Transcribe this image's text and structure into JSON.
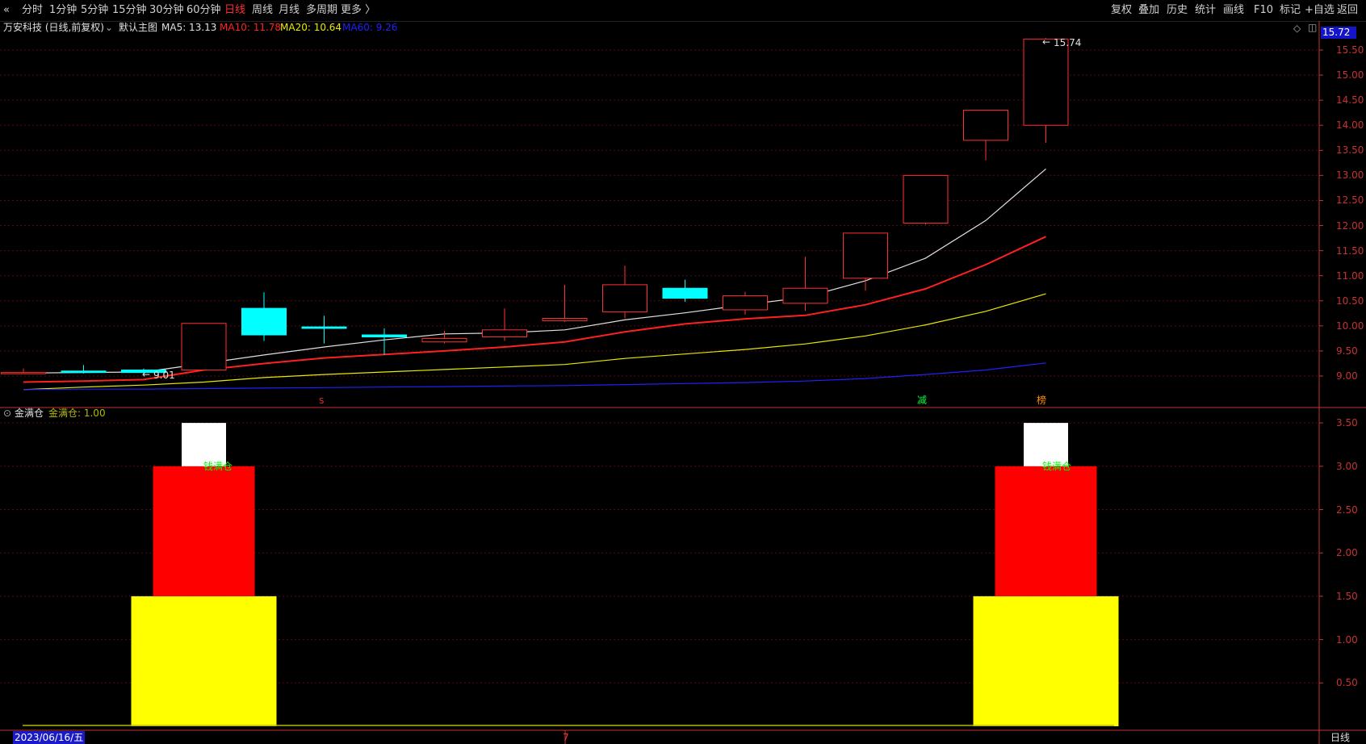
{
  "toolbar": {
    "back_glyph": "«",
    "periods": [
      "分时",
      "1分钟",
      "5分钟",
      "15分钟",
      "30分钟",
      "60分钟",
      "日线",
      "周线",
      "月线",
      "多周期",
      "更多 〉"
    ],
    "active_period": "日线",
    "right_buttons": [
      "复权",
      "叠加",
      "历史",
      "统计",
      "画线",
      "F10",
      "标记",
      "+自选",
      "返回"
    ]
  },
  "main_panel": {
    "stock_label": "万安科技 (日线,前复权)",
    "indicator_name": "默认主图",
    "ma5": "MA5: 13.13",
    "ma10": "MA10: 11.78",
    "ma20": "MA20: 10.64",
    "ma60": "MA60: 9.26",
    "current_price": "15.72",
    "high_marker": "15.74",
    "low_marker": "9.01",
    "signal_s": "S",
    "signal_jian": "减",
    "signal_bang": "榜",
    "ma_colors": {
      "ma5": "#e0e0e0",
      "ma10": "#ff2020",
      "ma20": "#e8e800",
      "ma60": "#2020ff"
    },
    "up_color": "#ff3030",
    "down_color": "#00ffff"
  },
  "sub_panel": {
    "title": "金满仓",
    "value_label": "金满仓: 1.00",
    "signal_text": "钱满仓"
  },
  "status": {
    "date": "2023/06/16/五",
    "mid_marker": "7",
    "period": "日线"
  },
  "chart_data": [
    {
      "type": "candlestick",
      "title": "万安科技 (日线,前复权)",
      "y_ticks": [
        9.0,
        9.5,
        10.0,
        10.5,
        11.0,
        11.5,
        12.0,
        12.5,
        13.0,
        13.5,
        14.0,
        14.5,
        15.0,
        15.5
      ],
      "ylim": [
        8.6,
        15.85
      ],
      "candles": [
        {
          "o": 9.07,
          "h": 9.15,
          "l": 9.05,
          "c": 9.07
        },
        {
          "o": 9.1,
          "h": 9.22,
          "l": 9.05,
          "c": 9.07
        },
        {
          "o": 9.12,
          "h": 9.15,
          "l": 9.01,
          "c": 9.07
        },
        {
          "o": 9.12,
          "h": 10.05,
          "l": 9.12,
          "c": 10.05
        },
        {
          "o": 10.35,
          "h": 10.67,
          "l": 9.7,
          "c": 9.82
        },
        {
          "o": 9.98,
          "h": 10.2,
          "l": 9.65,
          "c": 9.95
        },
        {
          "o": 9.82,
          "h": 9.95,
          "l": 9.42,
          "c": 9.78
        },
        {
          "o": 9.68,
          "h": 9.9,
          "l": 9.65,
          "c": 9.75
        },
        {
          "o": 9.78,
          "h": 10.35,
          "l": 9.7,
          "c": 9.92
        },
        {
          "o": 10.1,
          "h": 10.82,
          "l": 10.08,
          "c": 10.15
        },
        {
          "o": 10.28,
          "h": 11.2,
          "l": 10.15,
          "c": 10.82
        },
        {
          "o": 10.75,
          "h": 10.92,
          "l": 10.48,
          "c": 10.55
        },
        {
          "o": 10.32,
          "h": 10.68,
          "l": 10.22,
          "c": 10.6
        },
        {
          "o": 10.45,
          "h": 11.38,
          "l": 10.3,
          "c": 10.75
        },
        {
          "o": 10.95,
          "h": 11.85,
          "l": 10.7,
          "c": 11.85
        },
        {
          "o": 12.05,
          "h": 13.0,
          "l": 12.02,
          "c": 13.0
        },
        {
          "o": 13.7,
          "h": 14.3,
          "l": 13.3,
          "c": 14.3
        },
        {
          "o": 14.0,
          "h": 15.74,
          "l": 13.65,
          "c": 15.72
        }
      ],
      "series": [
        {
          "name": "MA5",
          "values": [
            9.06,
            9.07,
            9.08,
            9.25,
            9.42,
            9.58,
            9.72,
            9.84,
            9.86,
            9.92,
            10.12,
            10.26,
            10.42,
            10.57,
            10.9,
            11.35,
            12.1,
            13.13
          ]
        },
        {
          "name": "MA10",
          "values": [
            8.88,
            8.9,
            8.93,
            9.12,
            9.25,
            9.36,
            9.43,
            9.5,
            9.58,
            9.68,
            9.88,
            10.04,
            10.14,
            10.21,
            10.42,
            10.74,
            11.22,
            11.78
          ]
        },
        {
          "name": "MA20",
          "values": [
            8.73,
            8.78,
            8.82,
            8.88,
            8.97,
            9.03,
            9.08,
            9.13,
            9.18,
            9.23,
            9.35,
            9.44,
            9.53,
            9.64,
            9.8,
            10.02,
            10.29,
            10.64
          ]
        },
        {
          "name": "MA60",
          "values": [
            8.73,
            8.74,
            8.74,
            8.75,
            8.76,
            8.77,
            8.78,
            8.79,
            8.8,
            8.81,
            8.83,
            8.85,
            8.87,
            8.9,
            8.95,
            9.03,
            9.12,
            9.26
          ]
        }
      ]
    },
    {
      "type": "bar",
      "title": "金满仓",
      "y_ticks": [
        0.5,
        1.0,
        1.5,
        2.0,
        2.5,
        3.0,
        3.5
      ],
      "ylim": [
        0,
        3.55
      ],
      "signals": [
        {
          "candle_index": 3,
          "layers": [
            {
              "value": 1.5,
              "color": "#ffff00",
              "width": "wide"
            },
            {
              "value": 3.0,
              "color": "#ff0000",
              "width": "mid"
            },
            {
              "value": 3.5,
              "color": "#ffffff",
              "width": "narrow"
            }
          ]
        },
        {
          "candle_index": 17,
          "layers": [
            {
              "value": 1.5,
              "color": "#ffff00",
              "width": "wide"
            },
            {
              "value": 3.0,
              "color": "#ff0000",
              "width": "mid"
            },
            {
              "value": 3.5,
              "color": "#ffffff",
              "width": "narrow"
            }
          ]
        }
      ]
    }
  ]
}
